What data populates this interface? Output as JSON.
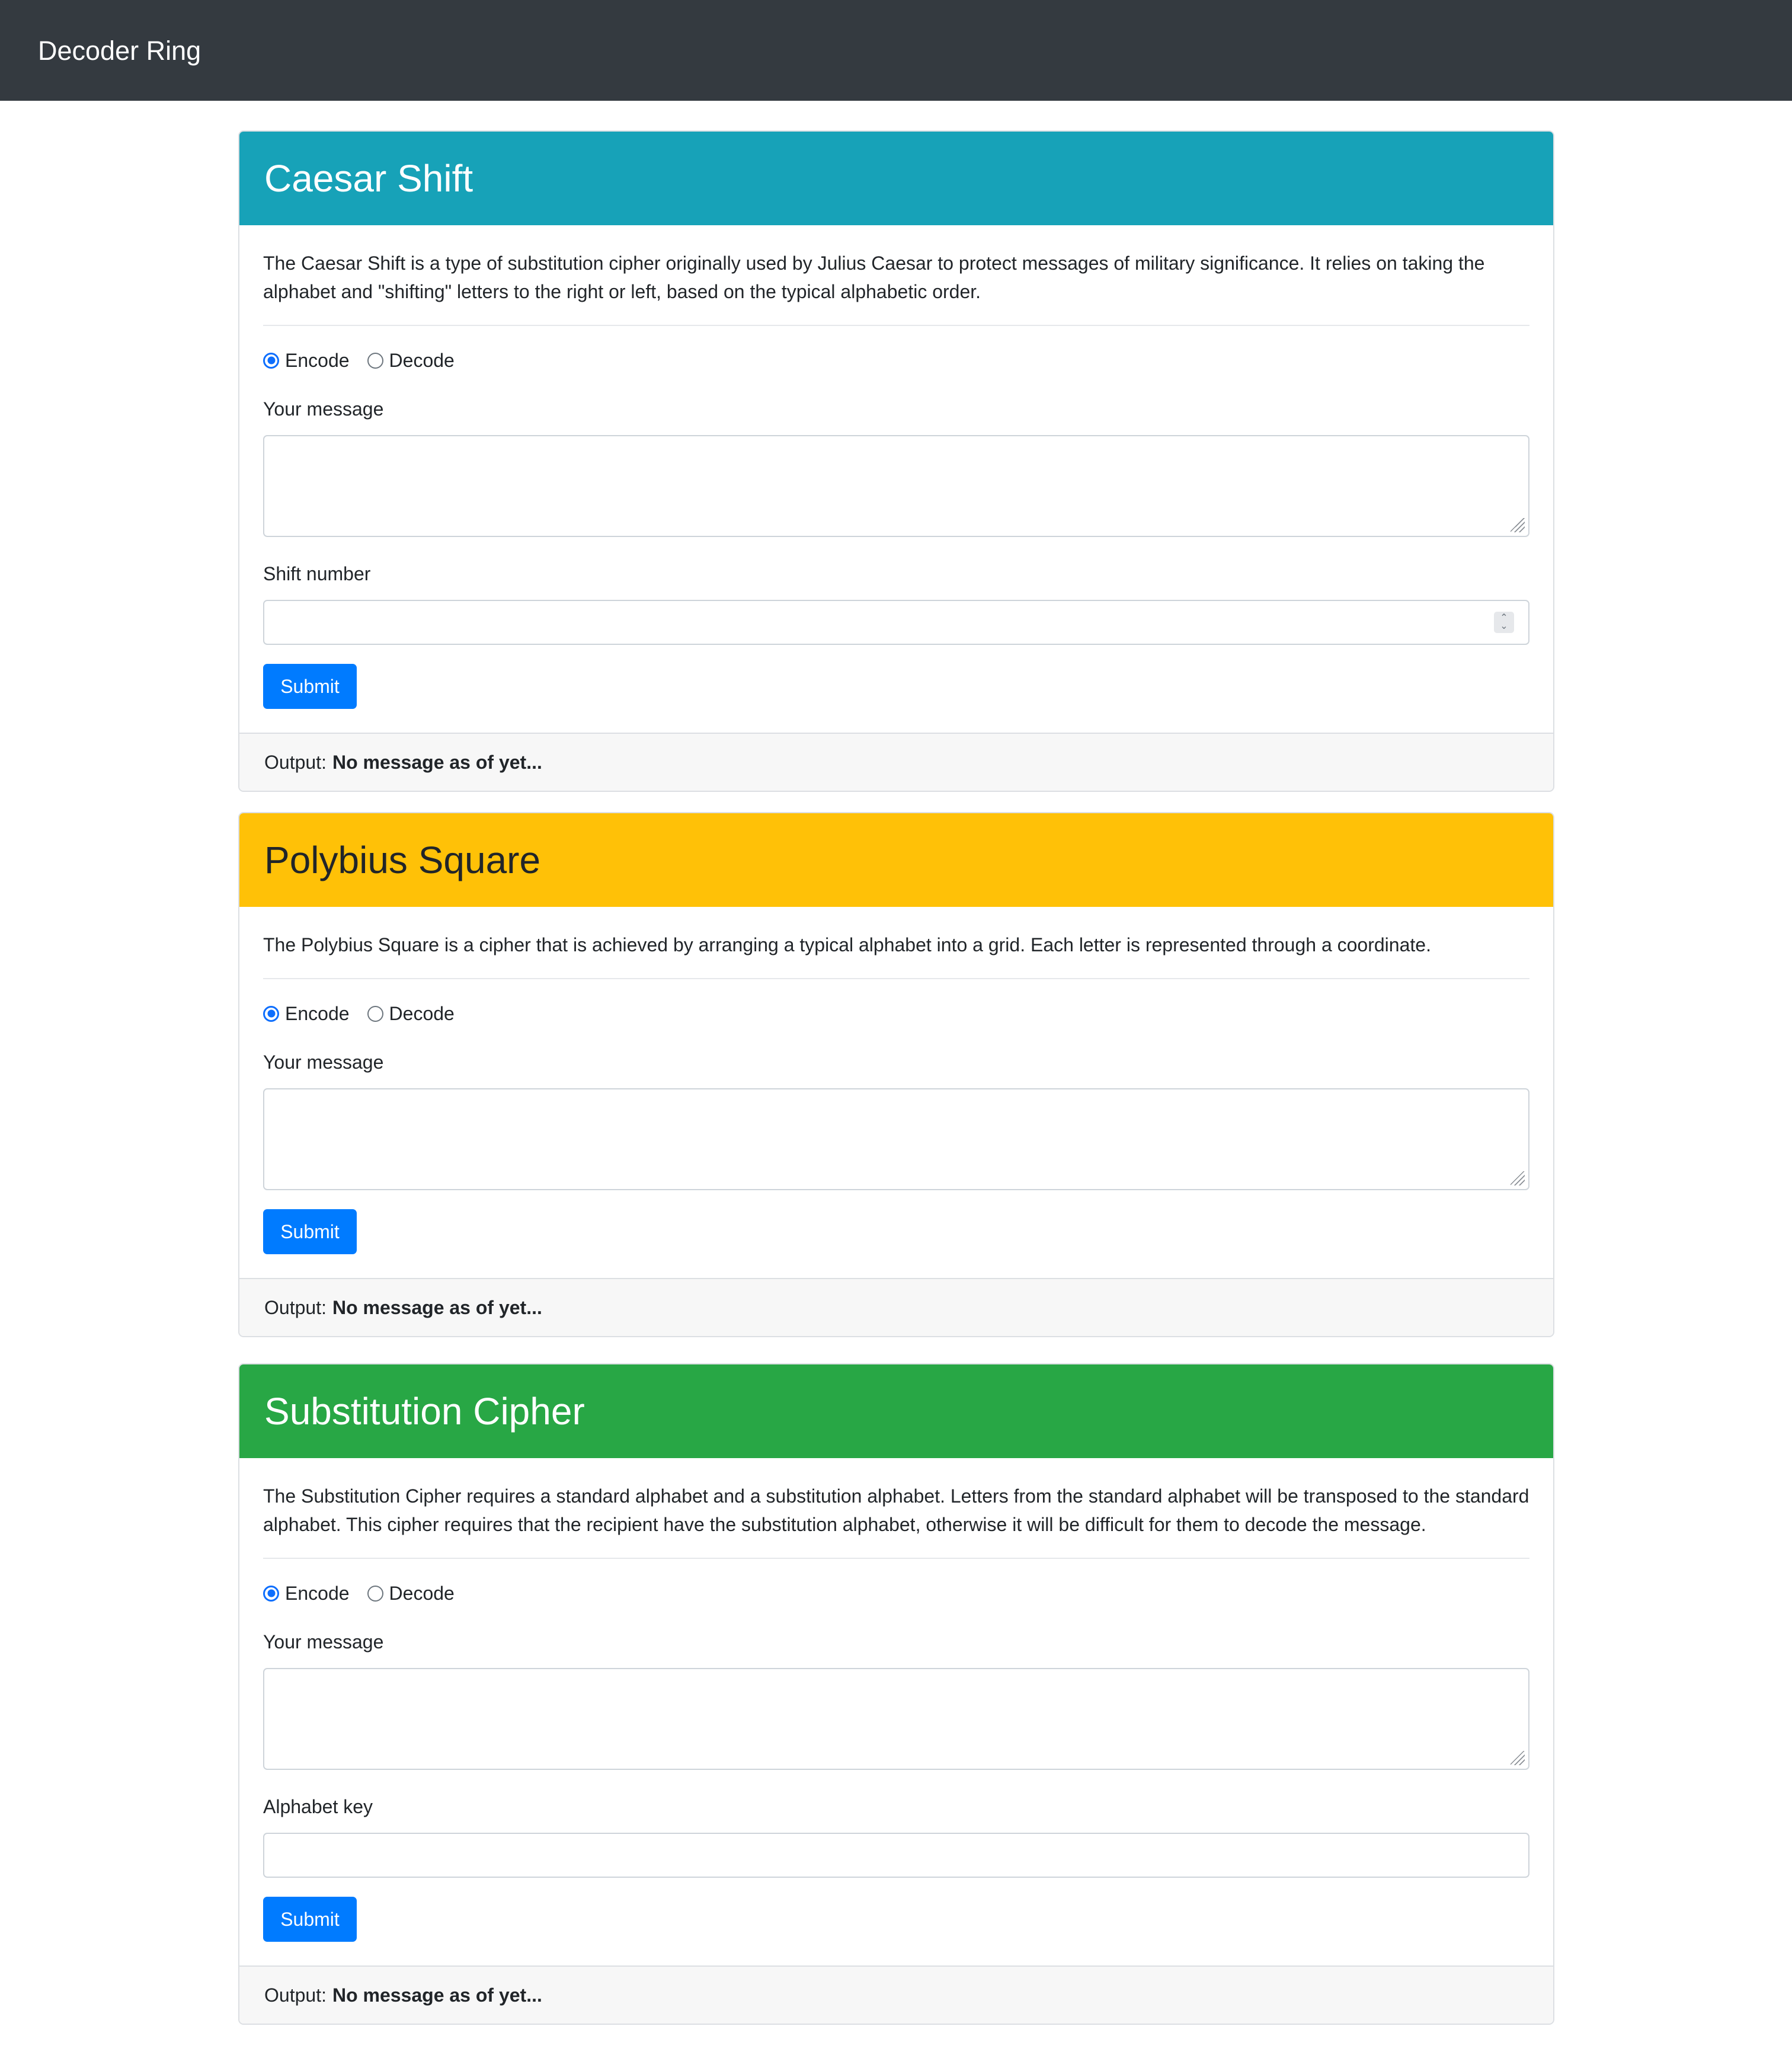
{
  "app": {
    "brand": "Decoder Ring"
  },
  "ciphers": [
    {
      "title": "Caesar Shift",
      "header_color": "#17a2b8",
      "title_color": "#ffffff",
      "description": "The Caesar Shift is a type of substitution cipher originally used by Julius Caesar to protect messages of military significance. It relies on taking the alphabet and \"shifting\" letters to the right or left, based on the typical alphabetic order.",
      "radio_encode": "Encode",
      "radio_decode": "Decode",
      "selected_mode": "Encode",
      "message_label": "Your message",
      "message_value": "",
      "extra_label": "Shift number",
      "extra_value": "",
      "submit_label": "Submit",
      "output_label": "Output:",
      "output_value": "No message as of yet..."
    },
    {
      "title": "Polybius Square",
      "header_color": "#ffc107",
      "title_color": "#212529",
      "description": "The Polybius Square is a cipher that is achieved by arranging a typical alphabet into a grid. Each letter is represented through a coordinate.",
      "radio_encode": "Encode",
      "radio_decode": "Decode",
      "selected_mode": "Encode",
      "message_label": "Your message",
      "message_value": "",
      "submit_label": "Submit",
      "output_label": "Output:",
      "output_value": "No message as of yet..."
    },
    {
      "title": "Substitution Cipher",
      "header_color": "#28a745",
      "title_color": "#ffffff",
      "description": "The Substitution Cipher requires a standard alphabet and a substitution alphabet. Letters from the standard alphabet will be transposed to the standard alphabet. This cipher requires that the recipient have the substitution alphabet, otherwise it will be difficult for them to decode the message.",
      "radio_encode": "Encode",
      "radio_decode": "Decode",
      "selected_mode": "Encode",
      "message_label": "Your message",
      "message_value": "",
      "extra_label": "Alphabet key",
      "extra_value": "",
      "submit_label": "Submit",
      "output_label": "Output:",
      "output_value": "No message as of yet..."
    }
  ]
}
